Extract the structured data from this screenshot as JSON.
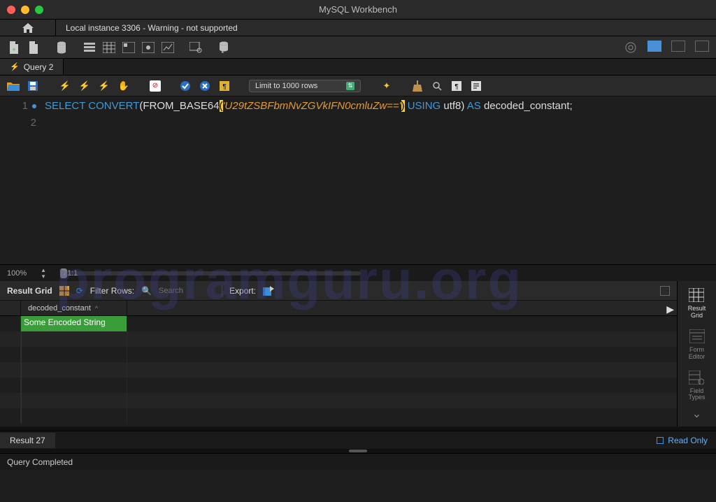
{
  "window": {
    "title": "MySQL Workbench"
  },
  "connection_tab": "Local instance 3306 - Warning - not supported",
  "query_tab": "Query 2",
  "limit_dropdown": "Limit to 1000 rows",
  "sql": {
    "line1": {
      "kw_select": "SELECT",
      "kw_convert": "CONVERT",
      "fn_from_base64": "FROM_BASE64",
      "str": "'U29tZSBFbmNvZGVkIFN0cmluZw=='",
      "kw_using": "USING",
      "charset": "utf8",
      "kw_as": "AS",
      "alias": "decoded_constant"
    },
    "gutter": [
      "1",
      "2"
    ]
  },
  "zoom": {
    "level": "100%",
    "pos": "71:1"
  },
  "gridbar": {
    "label": "Result Grid",
    "filter_label": "Filter Rows:",
    "filter_placeholder": "Search",
    "export_label": "Export:"
  },
  "side": {
    "result_grid": "Result\nGrid",
    "form_editor": "Form\nEditor",
    "field_types": "Field\nTypes"
  },
  "table": {
    "column": "decoded_constant",
    "rows": [
      "Some Encoded String"
    ]
  },
  "result_tab": "Result 27",
  "readonly": "Read Only",
  "status": "Query Completed",
  "watermark": "programguru.org"
}
